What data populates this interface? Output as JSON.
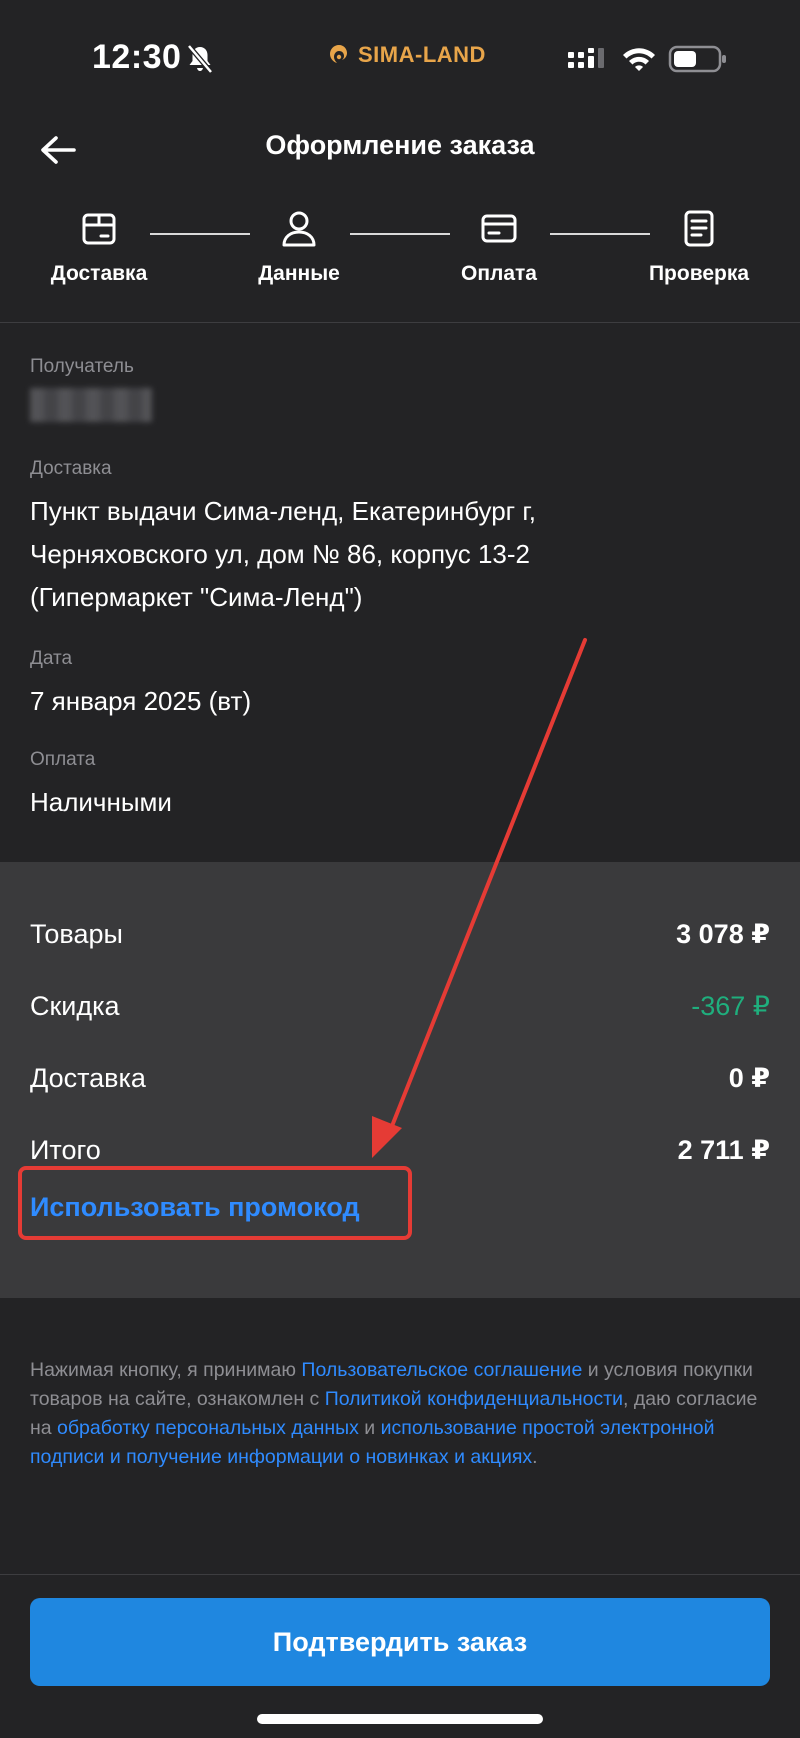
{
  "status_bar": {
    "time": "12:30",
    "brand": "SIMA-LAND",
    "icons": [
      "bell-off-icon",
      "signal-icon",
      "wifi-icon",
      "battery-icon"
    ]
  },
  "header": {
    "title": "Оформление заказа",
    "back_icon": "arrow-left-icon"
  },
  "steps": [
    {
      "label": "Доставка",
      "icon": "box-icon"
    },
    {
      "label": "Данные",
      "icon": "person-icon"
    },
    {
      "label": "Оплата",
      "icon": "card-icon"
    },
    {
      "label": "Проверка",
      "icon": "document-icon"
    }
  ],
  "details": {
    "recipient_label": "Получатель",
    "delivery_label": "Доставка",
    "delivery_line1": "Пункт выдачи Сима-ленд,  Екатеринбург г,",
    "delivery_line2": "Черняховского ул, дом № 86, корпус 13-2",
    "delivery_line3": "(Гипермаркет \"Сима-Ленд\")",
    "date_label": "Дата",
    "date_value": "7 января 2025 (вт)",
    "payment_label": "Оплата",
    "payment_value": "Наличными"
  },
  "summary": {
    "rows": [
      {
        "label": "Товары",
        "value": "3 078 ₽"
      },
      {
        "label": "Скидка",
        "value": "-367 ₽"
      },
      {
        "label": "Доставка",
        "value": "0 ₽"
      },
      {
        "label": "Итого",
        "value": "2 711 ₽"
      }
    ],
    "promo_link": "Использовать промокод"
  },
  "legal": {
    "part1": "Нажимая кнопку, я принимаю ",
    "link1": "Пользовательское соглашение",
    "part2": " и условия покупки товаров на сайте, ознакомлен с ",
    "link2": "Политикой конфиденциальности",
    "part3": ",  даю согласие на ",
    "link3": "обработку персональных данных",
    "part4": " и ",
    "link4": "использование простой электронной подписи и получение информации о новинках и акциях",
    "part5": "."
  },
  "confirm_button": "Подтвердить заказ",
  "colors": {
    "background": "#232325",
    "summary_bg": "#3a3a3c",
    "accent_blue": "#1f87e0",
    "link_blue": "#2f8bff",
    "discount_green": "#1fae7d",
    "annotation_red": "#e53b35",
    "brand_orange": "#e8a54a"
  }
}
